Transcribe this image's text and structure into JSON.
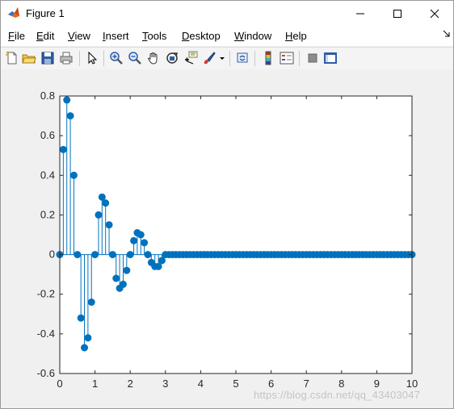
{
  "window": {
    "title": "Figure 1"
  },
  "menu": [
    {
      "label": "File",
      "key": "F",
      "rest": "ile"
    },
    {
      "label": "Edit",
      "key": "E",
      "rest": "dit"
    },
    {
      "label": "View",
      "key": "V",
      "rest": "iew"
    },
    {
      "label": "Insert",
      "key": "I",
      "rest": "nsert"
    },
    {
      "label": "Tools",
      "key": "T",
      "rest": "ools"
    },
    {
      "label": "Desktop",
      "key": "D",
      "rest": "esktop"
    },
    {
      "label": "Window",
      "key": "W",
      "rest": "indow"
    },
    {
      "label": "Help",
      "key": "H",
      "rest": "elp"
    }
  ],
  "toolbar": [
    "new-figure-icon",
    "open-file-icon",
    "save-icon",
    "print-icon",
    "select-arrow-icon",
    "zoom-in-icon",
    "zoom-out-icon",
    "pan-hand-icon",
    "rotate-3d-icon",
    "data-cursor-icon",
    "brush-icon",
    "link-plot-icon",
    "colorbar-icon",
    "legend-icon",
    "hide-plot-tools-icon",
    "show-plot-tools-icon"
  ],
  "watermark": "https://blog.csdn.net/qq_43403047",
  "colors": {
    "stem": "#0072bd",
    "axes_bg": "#ffffff",
    "figure_bg": "#f0f0f0"
  },
  "chart_data": {
    "type": "scatter",
    "style": "stem",
    "xlim": [
      0,
      10
    ],
    "ylim": [
      -0.6,
      0.8
    ],
    "xticks": [
      0,
      1,
      2,
      3,
      4,
      5,
      6,
      7,
      8,
      9,
      10
    ],
    "yticks": [
      -0.6,
      -0.4,
      -0.2,
      0,
      0.2,
      0.4,
      0.6,
      0.8
    ],
    "ytick_labels": [
      "-0.6",
      "-0.4",
      "-0.2",
      "0",
      "0.2",
      "0.4",
      "0.6",
      "0.8"
    ],
    "x_step": 0.1,
    "x_start": 0,
    "values": [
      0,
      0.53,
      0.78,
      0.7,
      0.4,
      0,
      -0.32,
      -0.47,
      -0.42,
      -0.24,
      0,
      0.2,
      0.29,
      0.26,
      0.15,
      0,
      -0.12,
      -0.17,
      -0.15,
      -0.08,
      0,
      0.07,
      0.11,
      0.1,
      0.06,
      0,
      -0.04,
      -0.06,
      -0.06,
      -0.03,
      0,
      0,
      0,
      0,
      0,
      0,
      0,
      0,
      0,
      0,
      0,
      0,
      0,
      0,
      0,
      0,
      0,
      0,
      0,
      0,
      0,
      0,
      0,
      0,
      0,
      0,
      0,
      0,
      0,
      0,
      0,
      0,
      0,
      0,
      0,
      0,
      0,
      0,
      0,
      0,
      0,
      0,
      0,
      0,
      0,
      0,
      0,
      0,
      0,
      0,
      0,
      0,
      0,
      0,
      0,
      0,
      0,
      0,
      0,
      0,
      0,
      0,
      0,
      0,
      0,
      0,
      0,
      0,
      0,
      0,
      0
    ],
    "grid": false,
    "title": "",
    "xlabel": "",
    "ylabel": ""
  }
}
